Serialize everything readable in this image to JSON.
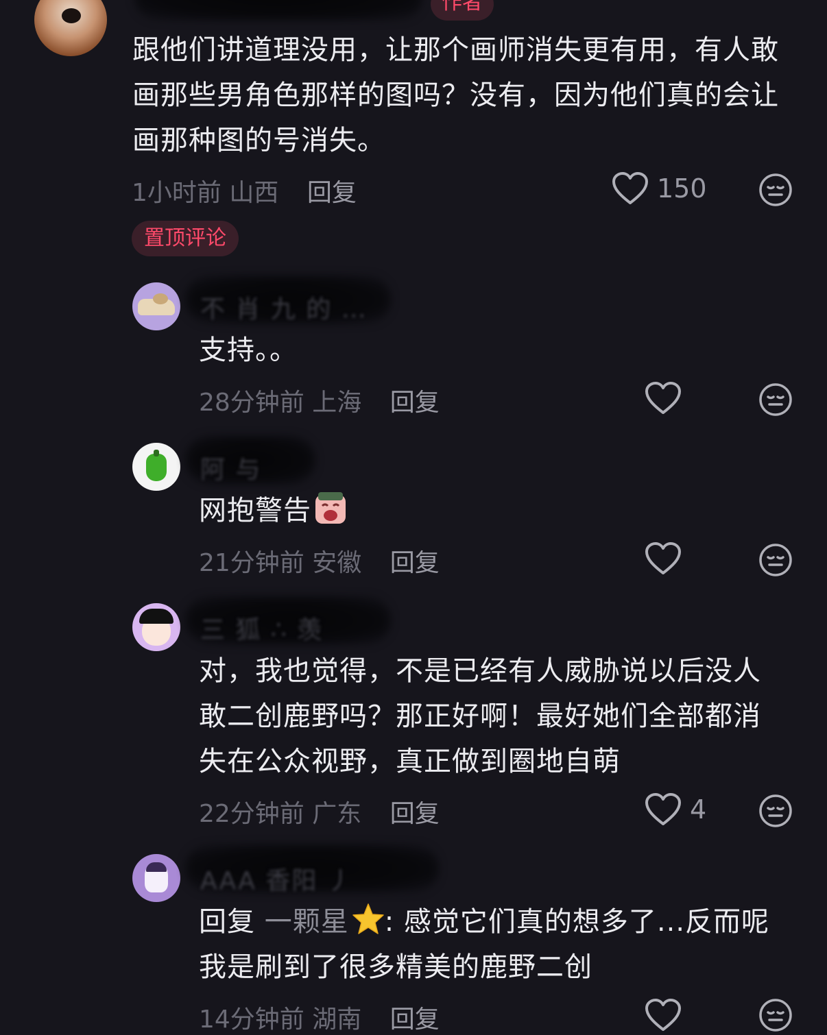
{
  "top_comment": {
    "author_badge": "作者",
    "lines": [
      "跟他们讲道理没用，让那个画师消失更有用，有人敢",
      "画那些男角色那样的图吗？没有，因为他们真的会让",
      "画那种图的号消失。"
    ],
    "time": "1小时前",
    "location": "山西",
    "reply_label": "回复",
    "likes": "150"
  },
  "pinned_badge": "置顶评论",
  "replies": [
    {
      "blurred_name": "不 肖 九 的 …",
      "text_lines": [
        "支持。。"
      ],
      "time": "28分钟前",
      "location": "上海",
      "reply_label": "回复",
      "likes": ""
    },
    {
      "blurred_name": "阿 与",
      "text_lines": [
        "网抱警告"
      ],
      "time": "21分钟前",
      "location": "安徽",
      "reply_label": "回复",
      "likes": ""
    },
    {
      "blurred_name": "三 狐 ∴ 羡",
      "text_lines": [
        "对，我也觉得，不是已经有人威胁说以后没人",
        "敢二创鹿野吗？那正好啊！最好她们全部都消",
        "失在公众视野，真正做到圈地自萌"
      ],
      "time": "22分钟前",
      "location": "广东",
      "reply_label": "回复",
      "likes": "4"
    },
    {
      "blurred_name": "AAA 香阳 丿",
      "reply_prefix": "回复",
      "reply_target": "一颗星",
      "text_lines": [
        ": 感觉它们真的想多了...反而呢",
        "我是刷到了很多精美的鹿野二创"
      ],
      "time": "14分钟前",
      "location": "湖南",
      "reply_label": "回复",
      "likes": ""
    }
  ],
  "colors": {
    "background": "#16151c",
    "badge_bg": "#3a1f29",
    "badge_text": "#ff4a6a",
    "meta_text": "#6b6b76",
    "icon": "#b0b0b8"
  }
}
